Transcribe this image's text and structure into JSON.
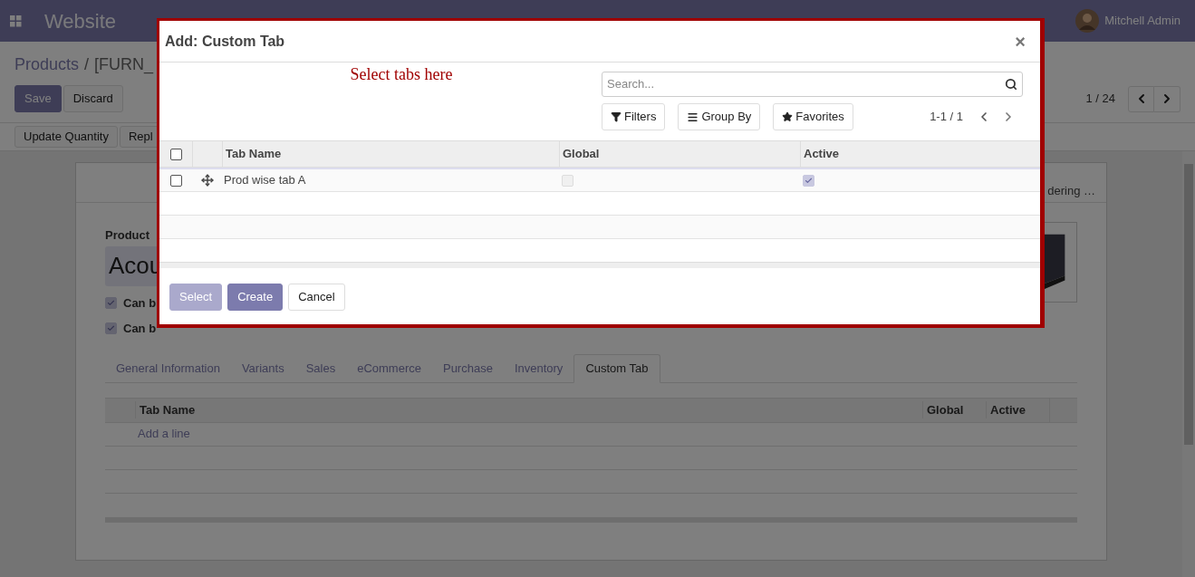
{
  "navbar": {
    "app_title": "Website",
    "user": "Mitchell Admin"
  },
  "breadcrumb": {
    "items": [
      "Products",
      "[FURN_"
    ],
    "separator": "/"
  },
  "control_buttons": [
    {
      "label": "Save",
      "kind": "primary"
    },
    {
      "label": "Discard",
      "kind": "secondary"
    }
  ],
  "pager": {
    "text": "1 / 24"
  },
  "action_buttons": [
    "Update Quantity",
    "Repl"
  ],
  "form": {
    "status_text": "dering …",
    "product_label": "Product",
    "name_value": "Acou",
    "checkboxes": [
      {
        "label": "Can b",
        "checked": true
      },
      {
        "label": "Can b",
        "checked": true
      }
    ],
    "notebook_tabs": [
      {
        "label": "General Information",
        "selected": false
      },
      {
        "label": "Variants",
        "selected": false
      },
      {
        "label": "Sales",
        "selected": false
      },
      {
        "label": "eCommerce",
        "selected": false
      },
      {
        "label": "Purchase",
        "selected": false
      },
      {
        "label": "Inventory",
        "selected": false
      },
      {
        "label": "Custom Tab",
        "selected": true
      }
    ],
    "lines_table": {
      "columns": [
        "Tab Name",
        "Global",
        "Active"
      ],
      "add_line": "Add a line"
    }
  },
  "modal": {
    "title": "Add: Custom Tab",
    "close": "×",
    "annotation": "Select tabs here",
    "search": {
      "placeholder": "Search..."
    },
    "filter_buttons": [
      {
        "label": "Filters",
        "kind": "filter"
      },
      {
        "label": "Group By",
        "kind": "group"
      },
      {
        "label": "Favorites",
        "kind": "favorites"
      }
    ],
    "pager": "1-1 / 1",
    "table": {
      "all_selected": false,
      "columns": [
        "Tab Name",
        "Global",
        "Active"
      ],
      "rows": [
        {
          "name": "Prod wise tab A",
          "selected": false,
          "global": false,
          "active": true
        }
      ]
    },
    "footer_buttons": [
      {
        "label": "Select",
        "kind": "primary",
        "disabled": true
      },
      {
        "label": "Create",
        "kind": "primary",
        "disabled": false
      },
      {
        "label": "Cancel",
        "kind": "secondary",
        "disabled": false
      }
    ]
  }
}
